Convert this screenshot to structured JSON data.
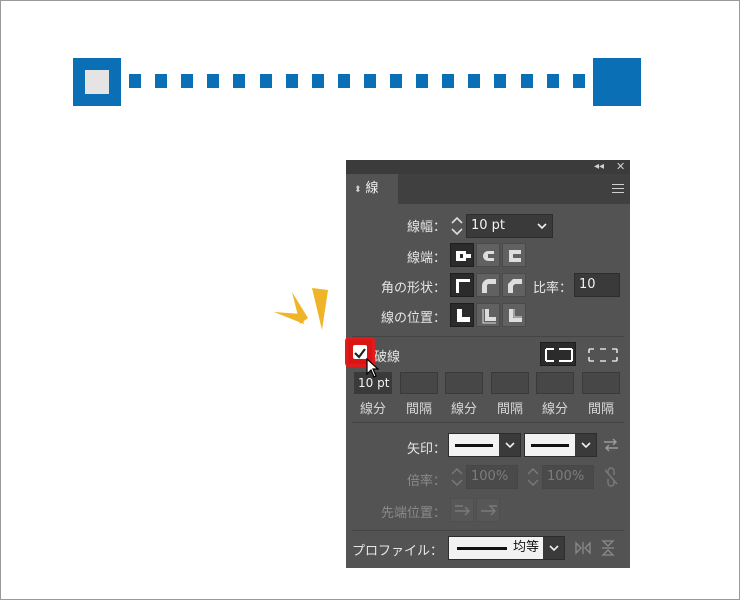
{
  "panel": {
    "tab_label": "線",
    "stroke_width": {
      "label": "線幅",
      "value": "10 pt"
    },
    "cap": {
      "label": "線端"
    },
    "corner": {
      "label": "角の形状",
      "ratio_label": "比率",
      "ratio_value": "10"
    },
    "align": {
      "label": "線の位置"
    },
    "dashed": {
      "checkbox_label": "破線",
      "checked": true,
      "fields": [
        {
          "value": "10 pt",
          "label": "線分"
        },
        {
          "value": "",
          "label": "間隔"
        },
        {
          "value": "",
          "label": "線分"
        },
        {
          "value": "",
          "label": "間隔"
        },
        {
          "value": "",
          "label": "線分"
        },
        {
          "value": "",
          "label": "間隔"
        }
      ]
    },
    "arrowheads": {
      "label": "矢印"
    },
    "scale": {
      "label": "倍率",
      "start_value": "100%",
      "end_value": "100%"
    },
    "align_arrow": {
      "label": "先端位置"
    },
    "profile": {
      "label": "プロファイル",
      "value": "均等"
    }
  },
  "colors": {
    "stroke_blue": "#0b6fb5",
    "panel_bg": "#535353",
    "highlight_red": "#e11b1b",
    "burst_yellow": "#f0b429"
  }
}
